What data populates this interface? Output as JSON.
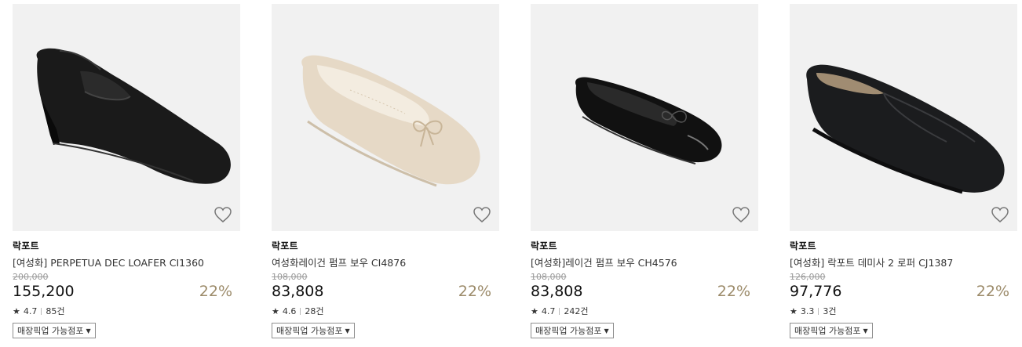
{
  "products": [
    {
      "brand": "락포트",
      "title": "[여성화] PERPETUA DEC LOAFER CI1360",
      "original_price": "200,000",
      "price": "155,200",
      "discount": "22%",
      "rating": "4.7",
      "reviews": "85건",
      "pickup_label": "매장픽업 가능점포",
      "image_icon": "black-penny-loafer"
    },
    {
      "brand": "락포트",
      "title": "여성화레이건 펌프 보우 CI4876",
      "original_price": "108,000",
      "price": "83,808",
      "discount": "22%",
      "rating": "4.6",
      "reviews": "28건",
      "pickup_label": "매장픽업 가능점포",
      "image_icon": "beige-patent-ballet-flat"
    },
    {
      "brand": "락포트",
      "title": "[여성화]레이건 펌프 보우 CH4576",
      "original_price": "108,000",
      "price": "83,808",
      "discount": "22%",
      "rating": "4.7",
      "reviews": "242건",
      "pickup_label": "매장픽업 가능점포",
      "image_icon": "black-patent-ballet-flat"
    },
    {
      "brand": "락포트",
      "title": "[여성화] 락포트 데미사 2 로퍼 CJ1387",
      "original_price": "126,000",
      "price": "97,776",
      "discount": "22%",
      "rating": "3.3",
      "reviews": "3건",
      "pickup_label": "매장픽업 가능점포",
      "image_icon": "black-moccasin-loafer"
    }
  ],
  "colors": {
    "discount": "#9c8b6a",
    "thumb_bg": "#f1f1f1"
  }
}
